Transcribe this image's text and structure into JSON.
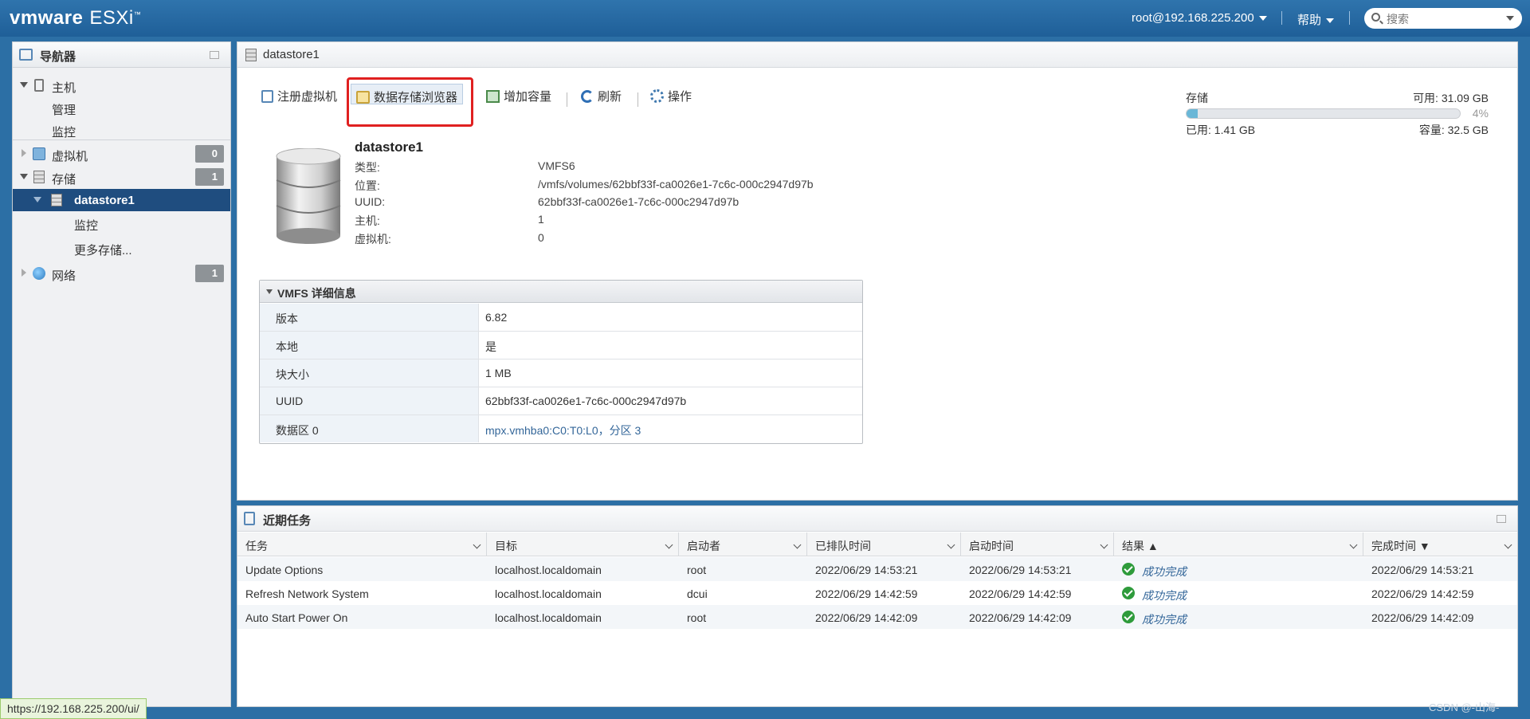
{
  "header": {
    "brand_vm": "vmware",
    "brand_esxi": "ESXi",
    "brand_tm": "™",
    "user": "root@192.168.225.200",
    "help": "帮助",
    "search_placeholder": "搜索"
  },
  "navigator": {
    "title": "导航器",
    "items": [
      {
        "label": "主机"
      },
      {
        "label": "管理"
      },
      {
        "label": "监控"
      },
      {
        "label": "虚拟机",
        "badge": "0"
      },
      {
        "label": "存储",
        "badge": "1"
      },
      {
        "label": "datastore1"
      },
      {
        "label": "监控"
      },
      {
        "label": "更多存储..."
      },
      {
        "label": "网络",
        "badge": "1"
      }
    ]
  },
  "main": {
    "title": "datastore1",
    "toolbar": {
      "register_vm": "注册虚拟机",
      "datastore_browser": "数据存储浏览器",
      "increase_capacity": "增加容量",
      "refresh": "刷新",
      "actions": "操作"
    },
    "storage": {
      "label": "存储",
      "free": "可用: 31.09 GB",
      "percent_text": "4%",
      "used_fraction": 0.04,
      "used": "已用: 1.41 GB",
      "capacity": "容量: 32.5 GB"
    },
    "datastore": {
      "name": "datastore1",
      "props": [
        {
          "key": "类型:",
          "value": "VMFS6"
        },
        {
          "key": "位置:",
          "value": "/vmfs/volumes/62bbf33f-ca0026e1-7c6c-000c2947d97b"
        },
        {
          "key": "UUID:",
          "value": "62bbf33f-ca0026e1-7c6c-000c2947d97b"
        },
        {
          "key": "主机:",
          "value": "1"
        },
        {
          "key": "虚拟机:",
          "value": "0"
        }
      ]
    },
    "vmfs": {
      "title": "VMFS 详细信息",
      "rows": [
        {
          "key": "版本",
          "value": "6.82"
        },
        {
          "key": "本地",
          "value": "是"
        },
        {
          "key": "块大小",
          "value": "1 MB"
        },
        {
          "key": "UUID",
          "value": "62bbf33f-ca0026e1-7c6c-000c2947d97b"
        },
        {
          "key": "数据区 0",
          "value": "mpx.vmhba0:C0:T0:L0，分区 3"
        }
      ]
    }
  },
  "tasks": {
    "title": "近期任务",
    "columns": [
      "任务",
      "目标",
      "启动者",
      "已排队时间",
      "启动时间",
      "结果 ▲",
      "完成时间 ▼"
    ],
    "rows": [
      {
        "task": "Update Options",
        "target": "localhost.localdomain",
        "initiator": "root",
        "queued": "2022/06/29 14:53:21",
        "started": "2022/06/29 14:53:21",
        "result": "成功完成",
        "completed": "2022/06/29 14:53:21"
      },
      {
        "task": "Refresh Network System",
        "target": "localhost.localdomain",
        "initiator": "dcui",
        "queued": "2022/06/29 14:42:59",
        "started": "2022/06/29 14:42:59",
        "result": "成功完成",
        "completed": "2022/06/29 14:42:59"
      },
      {
        "task": "Auto Start Power On",
        "target": "localhost.localdomain",
        "initiator": "root",
        "queued": "2022/06/29 14:42:09",
        "started": "2022/06/29 14:42:09",
        "result": "成功完成",
        "completed": "2022/06/29 14:42:09"
      }
    ]
  },
  "status_url": "https://192.168.225.200/ui/",
  "watermark": "CSDN @-山海-"
}
